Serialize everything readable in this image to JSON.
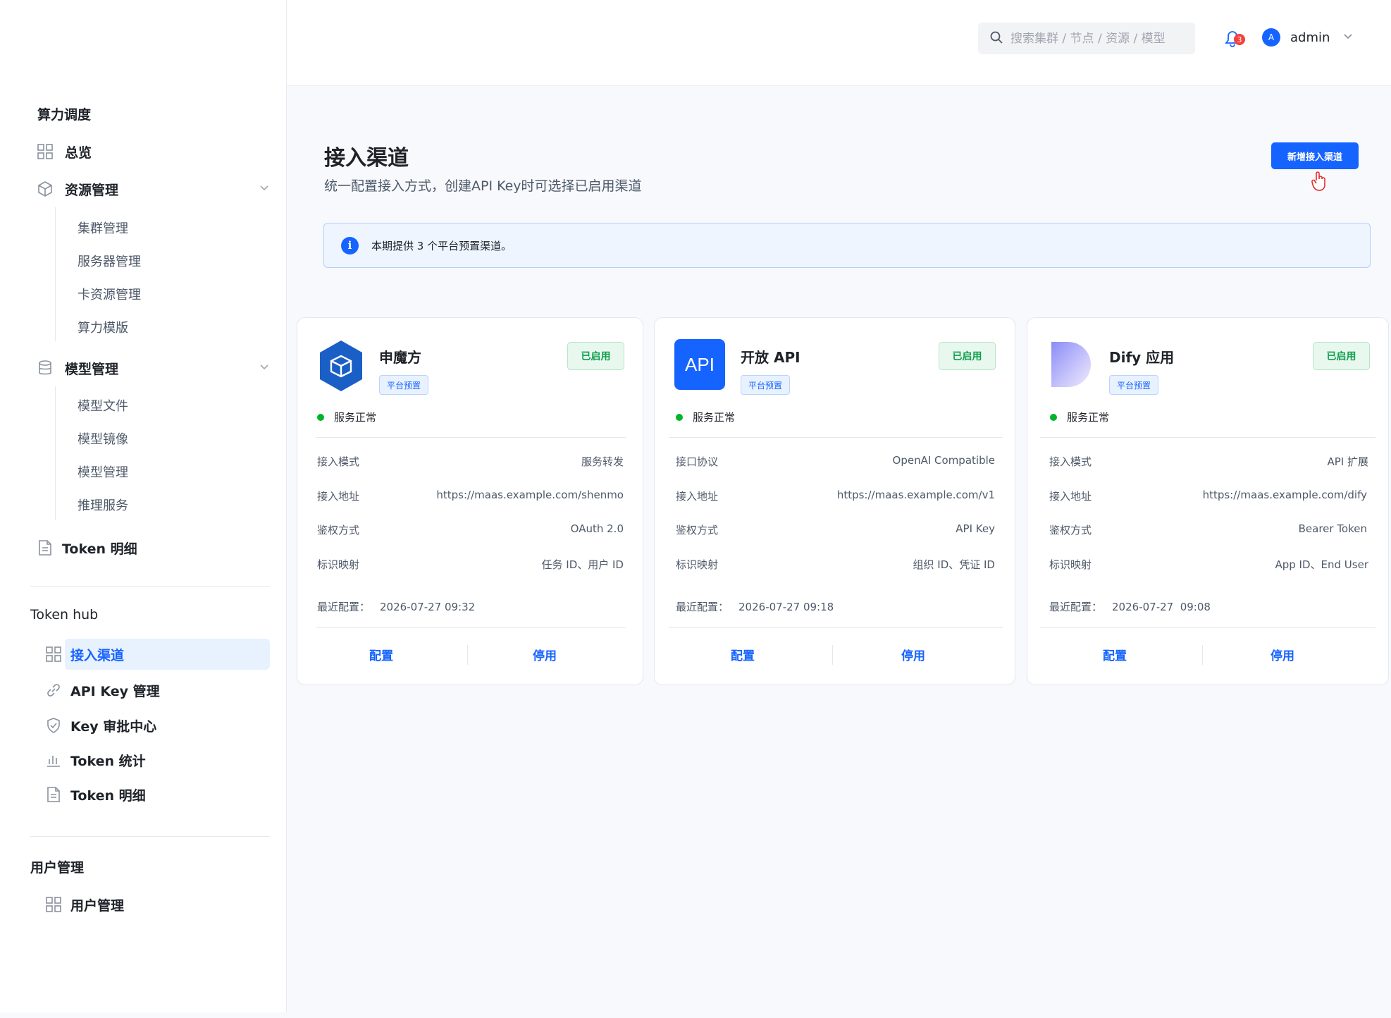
{
  "header": {
    "search_placeholder": "搜索集群 / 节点 / 资源 / 模型",
    "notification_count": "3",
    "avatar_letter": "A",
    "user_name": "admin"
  },
  "sidebar": {
    "group1_title": "算力调度",
    "overview": "总览",
    "resource_mgmt": "资源管理",
    "resource_sub": [
      "集群管理",
      "服务器管理",
      "卡资源管理",
      "算力模版"
    ],
    "model_mgmt": "模型管理",
    "model_sub": [
      "模型文件",
      "模型镜像",
      "模型管理",
      "推理服务"
    ],
    "token_detail_top": "Token 明细",
    "group2_title": "Token hub",
    "hub_items": [
      "接入渠道",
      "API Key 管理",
      "Key 审批中心",
      "Token 统计",
      "Token 明细"
    ],
    "group3_title": "用户管理",
    "user_mgmt": "用户管理"
  },
  "page": {
    "title": "接入渠道",
    "subtitle": "统一配置接入方式，创建API Key时可选择已启用渠道",
    "add_button": "新增接入渠道",
    "alert_icon": "i",
    "alert_text": "本期提供 3 个平台预置渠道。"
  },
  "cards": [
    {
      "name": "申魔方",
      "tag": "平台预置",
      "status": "已启用",
      "health": "服务正常",
      "rows": [
        {
          "label": "接入模式",
          "value": "服务转发"
        },
        {
          "label": "接入地址",
          "value": "https://maas.example.com/shenmo"
        },
        {
          "label": "鉴权方式",
          "value": "OAuth 2.0"
        },
        {
          "label": "标识映射",
          "value": "任务 ID、用户 ID"
        }
      ],
      "recent_label": "最近配置：",
      "recent_value": "2026-07-27 09:32",
      "configure": "配置",
      "disable": "停用"
    },
    {
      "name": "开放 API",
      "logo_text": "API",
      "tag": "平台预置",
      "status": "已启用",
      "health": "服务正常",
      "rows": [
        {
          "label": "接口协议",
          "value": "OpenAI Compatible"
        },
        {
          "label": "接入地址",
          "value": "https://maas.example.com/v1"
        },
        {
          "label": "鉴权方式",
          "value": "API Key"
        },
        {
          "label": "标识映射",
          "value": "组织 ID、凭证 ID"
        }
      ],
      "recent_label": "最近配置：",
      "recent_value": "2026-07-27 09:18",
      "configure": "配置",
      "disable": "停用"
    },
    {
      "name": "Dify 应用",
      "tag": "平台预置",
      "status": "已启用",
      "health": "服务正常",
      "rows": [
        {
          "label": "接入模式",
          "value": "API 扩展"
        },
        {
          "label": "接入地址",
          "value": "https://maas.example.com/dify"
        },
        {
          "label": "鉴权方式",
          "value": "Bearer Token"
        },
        {
          "label": "标识映射",
          "value": "App ID、End User"
        }
      ],
      "recent_label": "最近配置：",
      "recent_value": "2026-07-27  09:08",
      "configure": "配置",
      "disable": "停用"
    }
  ],
  "colors": {
    "primary": "#1664ff",
    "success": "#00b42a",
    "danger": "#f53f3f",
    "active_bg": "#e8f1fe"
  },
  "icons": {
    "search": "search-icon",
    "bell": "bell-icon",
    "chevron": "chevron-down-icon",
    "grid": "grid-icon",
    "cube": "cube-icon",
    "database": "database-icon",
    "document": "document-icon",
    "link": "link-icon",
    "shield": "shield-check-icon",
    "bar_chart": "bar-chart-icon",
    "info": "info-icon",
    "hand_pointer": "hand-pointer-icon"
  }
}
